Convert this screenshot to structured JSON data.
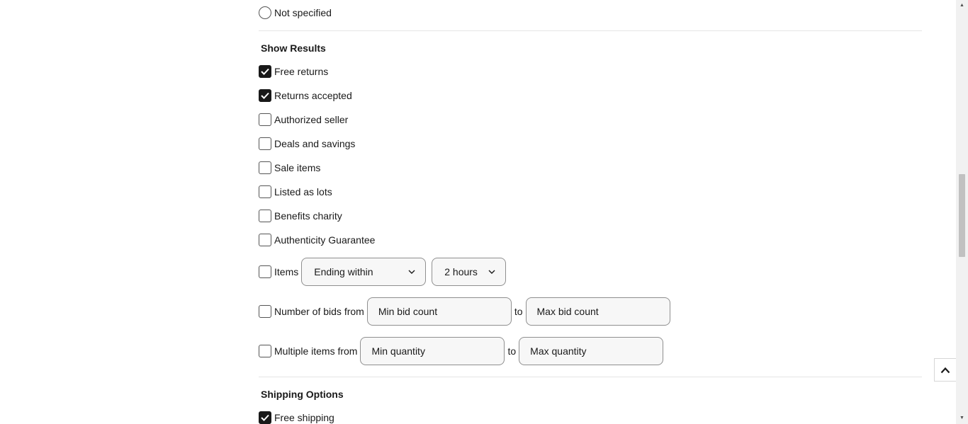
{
  "condition": {
    "not_specified_label": "Not specified"
  },
  "show_results": {
    "title": "Show Results",
    "options": [
      {
        "label": "Free returns",
        "checked": true
      },
      {
        "label": "Returns accepted",
        "checked": true
      },
      {
        "label": "Authorized seller",
        "checked": false
      },
      {
        "label": "Deals and savings",
        "checked": false
      },
      {
        "label": "Sale items",
        "checked": false
      },
      {
        "label": "Listed as lots",
        "checked": false
      },
      {
        "label": "Benefits charity",
        "checked": false
      },
      {
        "label": "Authenticity Guarantee",
        "checked": false
      }
    ],
    "items_label": "Items",
    "ending_select_value": "Ending within",
    "hours_select_value": "2 hours",
    "bids_label": "Number of bids from",
    "min_bid_placeholder": "Min bid count",
    "to_label": "to",
    "max_bid_placeholder": "Max bid count",
    "multiple_label": "Multiple items from",
    "min_qty_placeholder": "Min quantity",
    "max_qty_placeholder": "Max quantity"
  },
  "shipping_options": {
    "title": "Shipping Options",
    "free_shipping_label": "Free shipping",
    "free_shipping_checked": true
  },
  "icons": {
    "back_to_top": "chevron-up-icon",
    "select_arrow": "chevron-down-icon",
    "check": "checkmark-icon"
  }
}
